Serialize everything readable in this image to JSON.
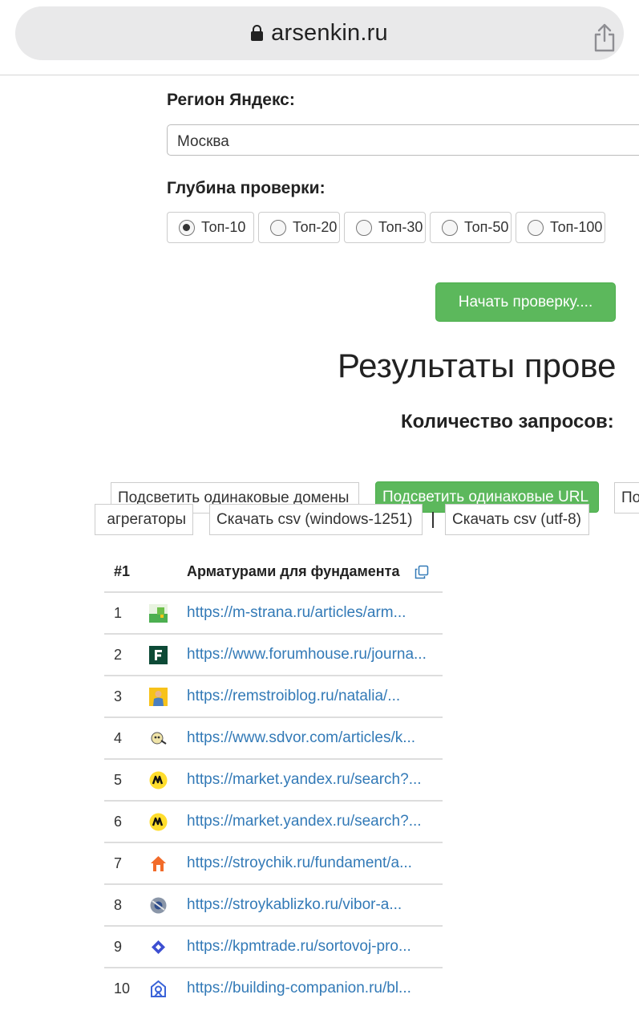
{
  "browser": {
    "host": "arsenkin.ru"
  },
  "form": {
    "region_label": "Регион Яндекс:",
    "region_value": "Москва",
    "depth_label": "Глубина проверки:",
    "depth_options": [
      {
        "label": "Топ-10",
        "checked": true
      },
      {
        "label": "Топ-20",
        "checked": false
      },
      {
        "label": "Топ-30",
        "checked": false
      },
      {
        "label": "Топ-50",
        "checked": false
      },
      {
        "label": "Топ-100",
        "checked": false
      }
    ],
    "start_button": "Начать проверку...."
  },
  "results": {
    "title": "Результаты прове",
    "count_label": "Количество запросов:",
    "toolbar": {
      "highlight_domains": "Подсветить одинаковые домены",
      "highlight_urls": "Подсветить одинаковые URL",
      "partial_next": "По",
      "aggregators": "агрегаторы",
      "download_windows": "Скачать csv (windows-1251)",
      "download_utf8": "Скачать csv (utf-8)"
    },
    "table": {
      "col_num": "#1",
      "col_query": "Арматурами для фундамента",
      "rows": [
        {
          "n": "1",
          "url": "https://m-strana.ru/articles/arm...",
          "favicon": "m-strana-icon"
        },
        {
          "n": "2",
          "url": "https://www.forumhouse.ru/journa...",
          "favicon": "forumhouse-icon"
        },
        {
          "n": "3",
          "url": "https://remstroiblog.ru/natalia/...",
          "favicon": "remstroiblog-icon"
        },
        {
          "n": "4",
          "url": "https://www.sdvor.com/articles/k...",
          "favicon": "sdvor-icon"
        },
        {
          "n": "5",
          "url": "https://market.yandex.ru/search?...",
          "favicon": "yandex-market-icon"
        },
        {
          "n": "6",
          "url": "https://market.yandex.ru/search?...",
          "favicon": "yandex-market-icon"
        },
        {
          "n": "7",
          "url": "https://stroychik.ru/fundament/a...",
          "favicon": "stroychik-icon"
        },
        {
          "n": "8",
          "url": "https://stroykablizko.ru/vibor-a...",
          "favicon": "stroykablizko-icon"
        },
        {
          "n": "9",
          "url": "https://kpmtrade.ru/sortovoj-pro...",
          "favicon": "kpmtrade-icon"
        },
        {
          "n": "10",
          "url": "https://building-companion.ru/bl...",
          "favicon": "building-companion-icon"
        }
      ]
    }
  },
  "colors": {
    "accent_green": "#5cb85c",
    "link_blue": "#337ab7"
  }
}
